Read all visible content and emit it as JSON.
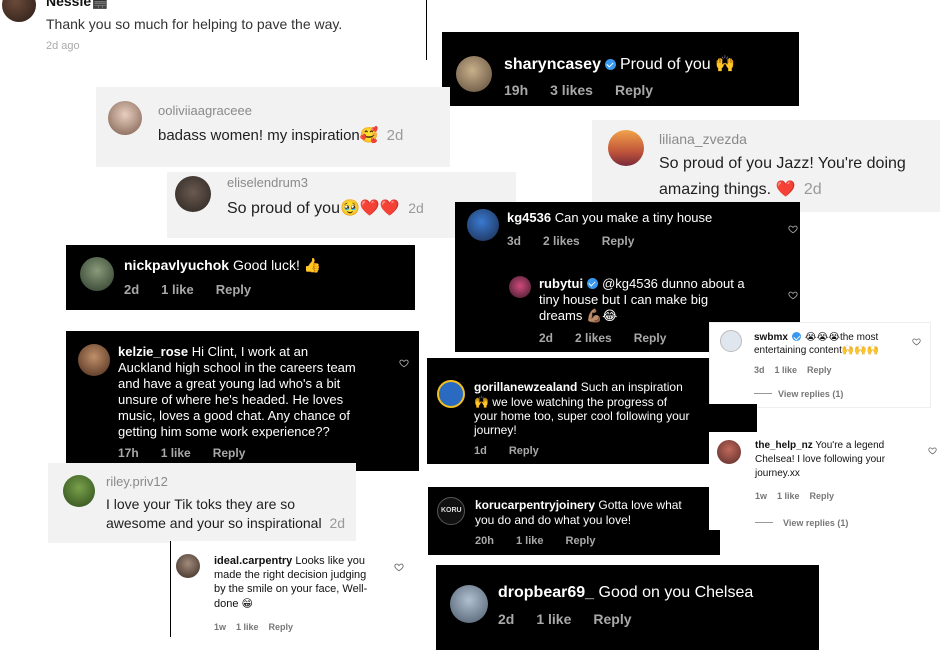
{
  "comments": {
    "nessie": {
      "user": "Nessie🎬",
      "text": "Thank you so much for helping to pave the way.",
      "time": "2d ago"
    },
    "sharyncasey": {
      "user": "sharyncasey",
      "text": "Proud of you 🙌",
      "time": "19h",
      "likes": "3 likes",
      "reply": "Reply"
    },
    "ooliviia": {
      "user": "ooliviiaagraceee",
      "text": "badass women! my inspiration🥰",
      "time": "2d"
    },
    "liliana": {
      "user": "liliana_zvezda",
      "text1": "So proud of you Jazz! You're doing",
      "text2": "amazing things. ❤️",
      "time": "2d"
    },
    "elise": {
      "user": "eliselendrum3",
      "text": "So proud of you🥹❤️❤️",
      "time": "2d"
    },
    "kg4536": {
      "user": "kg4536",
      "text": "Can you make a tiny house",
      "time": "3d",
      "likes": "2 likes",
      "reply": "Reply"
    },
    "rubytui": {
      "user": "rubytui",
      "text1": "@kg4536 dunno about a",
      "text2": "tiny house but I can make big",
      "text3": "dreams 💪🏽😂",
      "time": "2d",
      "likes": "2 likes",
      "reply": "Reply"
    },
    "nick": {
      "user": "nickpavlyuchok",
      "text": "Good luck! 👍",
      "time": "2d",
      "likes": "1 like",
      "reply": "Reply"
    },
    "swbmx": {
      "user": "swbmx",
      "text1": "😭😭😭the most",
      "text2": "entertaining content🙌🙌🙌",
      "time": "3d",
      "likes": "1 like",
      "reply": "Reply",
      "view": "View replies (1)"
    },
    "kelzie": {
      "user": "kelzie_rose",
      "lines": [
        "Hi Clint, I work at an",
        "Auckland high school in the careers team",
        "and have a great young lad who's a bit",
        "unsure of where he's headed. He loves",
        "music, loves a good chat. Any chance of",
        "getting him some work experience??"
      ],
      "time": "17h",
      "likes": "1 like",
      "reply": "Reply"
    },
    "gorilla": {
      "user": "gorillanewzealand",
      "text1": "Such an inspiration",
      "text2": "🙌 we love watching the progress of",
      "text3": "your home too, super cool following your",
      "text4": "journey!",
      "time": "1d",
      "reply": "Reply"
    },
    "thehelp": {
      "user": "the_help_nz",
      "text1": "You're a legend",
      "text2": "Chelsea! I love following your",
      "text3": "journey.xx",
      "time": "1w",
      "likes": "1 like",
      "reply": "Reply",
      "view": "View replies (1)"
    },
    "riley": {
      "user": "riley.priv12",
      "text1": "I love your Tik toks they are so",
      "text2": "awesome and your so inspirational",
      "time": "2d"
    },
    "koru": {
      "user": "korucarpentryjoinery",
      "text1": "Gotta love what",
      "text2": "you do and do what you love!",
      "time": "20h",
      "likes": "1 like",
      "reply": "Reply",
      "logo": "KORU"
    },
    "ideal": {
      "user": "ideal.carpentry",
      "text1": "Looks like you",
      "text2": "made the right decision judging",
      "text3": "by the smile on your face, Well-",
      "text4": "done 😁",
      "time": "1w",
      "likes": "1 like",
      "reply": "Reply"
    },
    "dropbear": {
      "user": "dropbear69_",
      "text": "Good on you Chelsea",
      "time": "2d",
      "likes": "1 like",
      "reply": "Reply"
    }
  },
  "icons": {
    "heart": "heart-outline-icon",
    "verified": "verified-badge-icon",
    "avatar": "avatar"
  },
  "colors": {
    "dark_bg": "#000000",
    "light_bg": "#f2f2f2",
    "verified": "#3897f0"
  }
}
